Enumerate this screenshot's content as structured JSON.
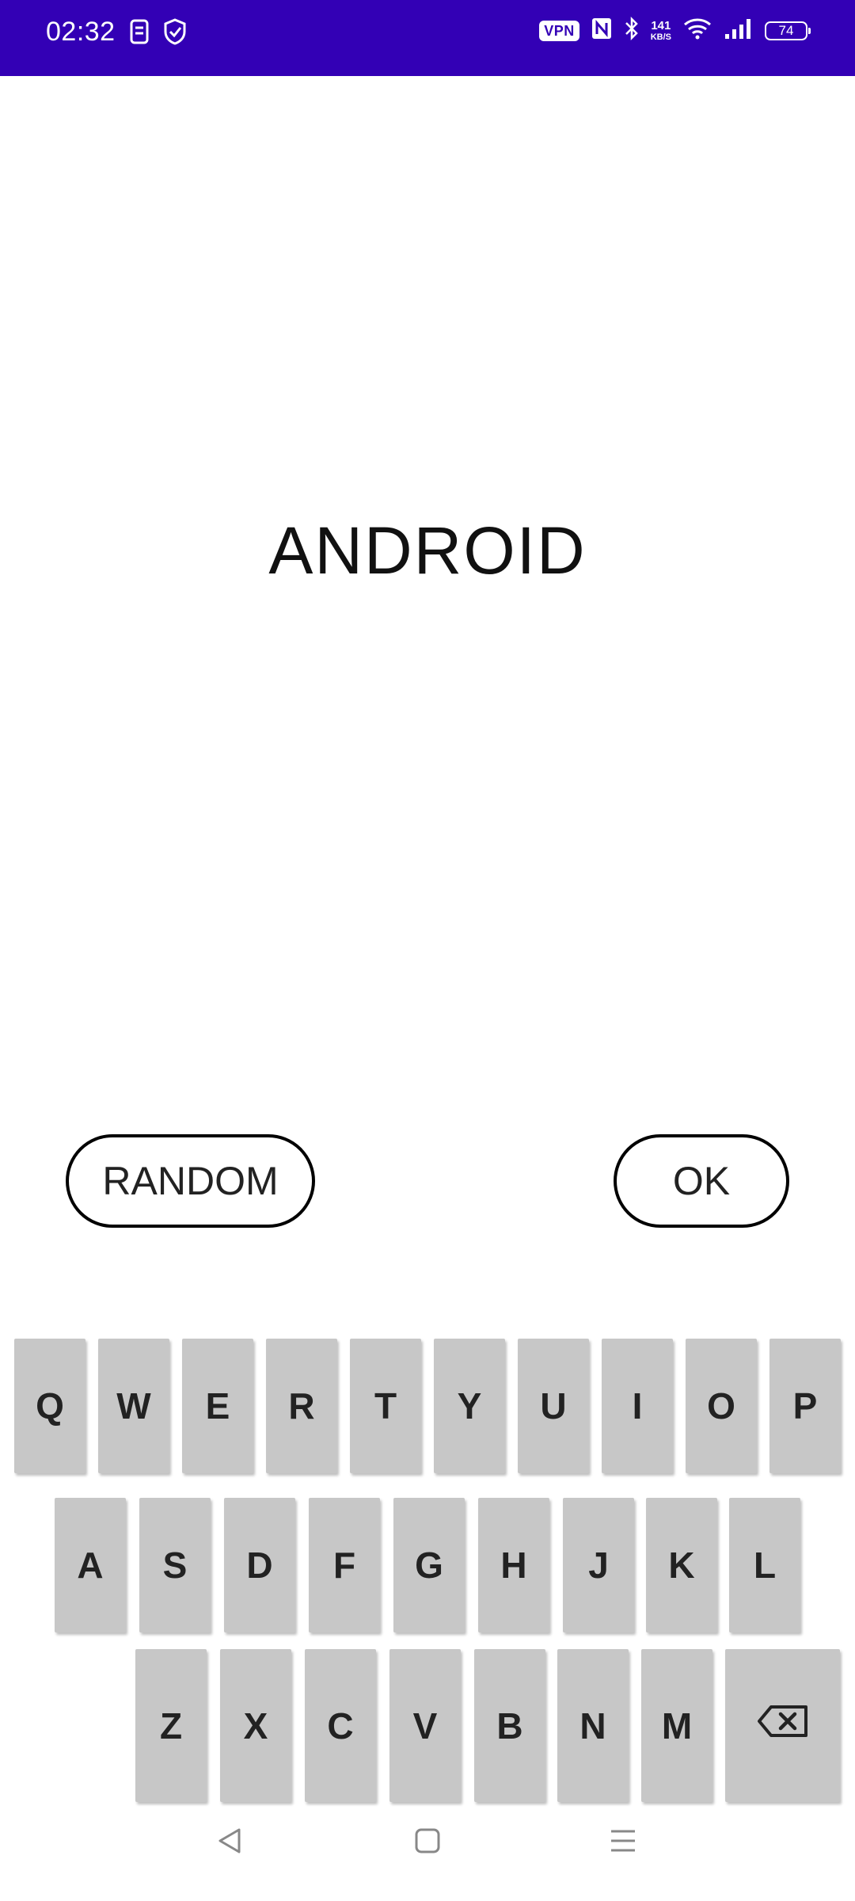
{
  "status_bar": {
    "time": "02:32",
    "vpn_label": "VPN",
    "net_speed_value": "141",
    "net_speed_unit": "KB/S",
    "battery": "74",
    "icons": [
      "sim-icon",
      "shield-check-icon",
      "nfc-icon",
      "bluetooth-icon",
      "wifi-icon",
      "signal-icon",
      "battery-icon"
    ]
  },
  "main": {
    "word": "ANDROID"
  },
  "buttons": {
    "random_label": "RANDOM",
    "ok_label": "OK"
  },
  "keyboard": {
    "row1": [
      "Q",
      "W",
      "E",
      "R",
      "T",
      "Y",
      "U",
      "I",
      "O",
      "P"
    ],
    "row2": [
      "A",
      "S",
      "D",
      "F",
      "G",
      "H",
      "J",
      "K",
      "L"
    ],
    "row3": [
      "Z",
      "X",
      "C",
      "V",
      "B",
      "N",
      "M"
    ],
    "backspace_icon": "backspace-icon"
  },
  "nav_bar": {
    "icons": [
      "back-icon",
      "home-icon",
      "recents-icon"
    ]
  },
  "colors": {
    "status_bar": "#3300b5",
    "key_bg": "#c7c7c7",
    "text": "#222222"
  }
}
